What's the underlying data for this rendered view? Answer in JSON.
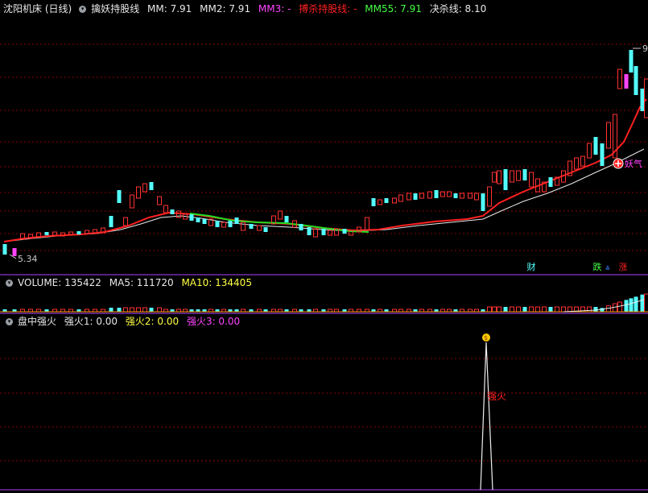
{
  "main_header": {
    "stock_title": "沈阳机床 (日线)",
    "indicator_name": "擒妖持股线",
    "mm_label": "MM: 7.91",
    "mm2_label": "MM2: 7.91",
    "mm3_label": "MM3: -",
    "buy_line_label": "搏杀持股线: -",
    "mm55_label": "MM55: 7.91",
    "kill_line_label": "决杀线: 8.10"
  },
  "price_labels": {
    "low_value": "5.34",
    "high_value": "9",
    "annotation_text": "妖气"
  },
  "markers": {
    "cai": "财",
    "die": "跌",
    "zhang": "涨"
  },
  "volume_header": {
    "volume_label": "VOLUME: 135422",
    "ma5_label": "MA5: 111720",
    "ma10_label": "MA10: 134405"
  },
  "bottom_header": {
    "indicator_name": "盘中强火",
    "q1_label": "强火1: 0.00",
    "q2_label": "强火2: 0.00",
    "q3_label": "强火3: 0.00"
  },
  "spike_label": "强火",
  "colors": {
    "background": "#000000",
    "up_candle": "#ff3232",
    "down_candle": "#54ffff",
    "ma_red": "#ff2020",
    "ma_white": "#e8e8e8",
    "ma_green": "#22dd22",
    "purple_rule": "#b040ff",
    "grid_red": "#8b0000",
    "magenta_text": "#ff44ff",
    "yellow_text": "#ffff44",
    "lime_text": "#44ff44"
  }
}
